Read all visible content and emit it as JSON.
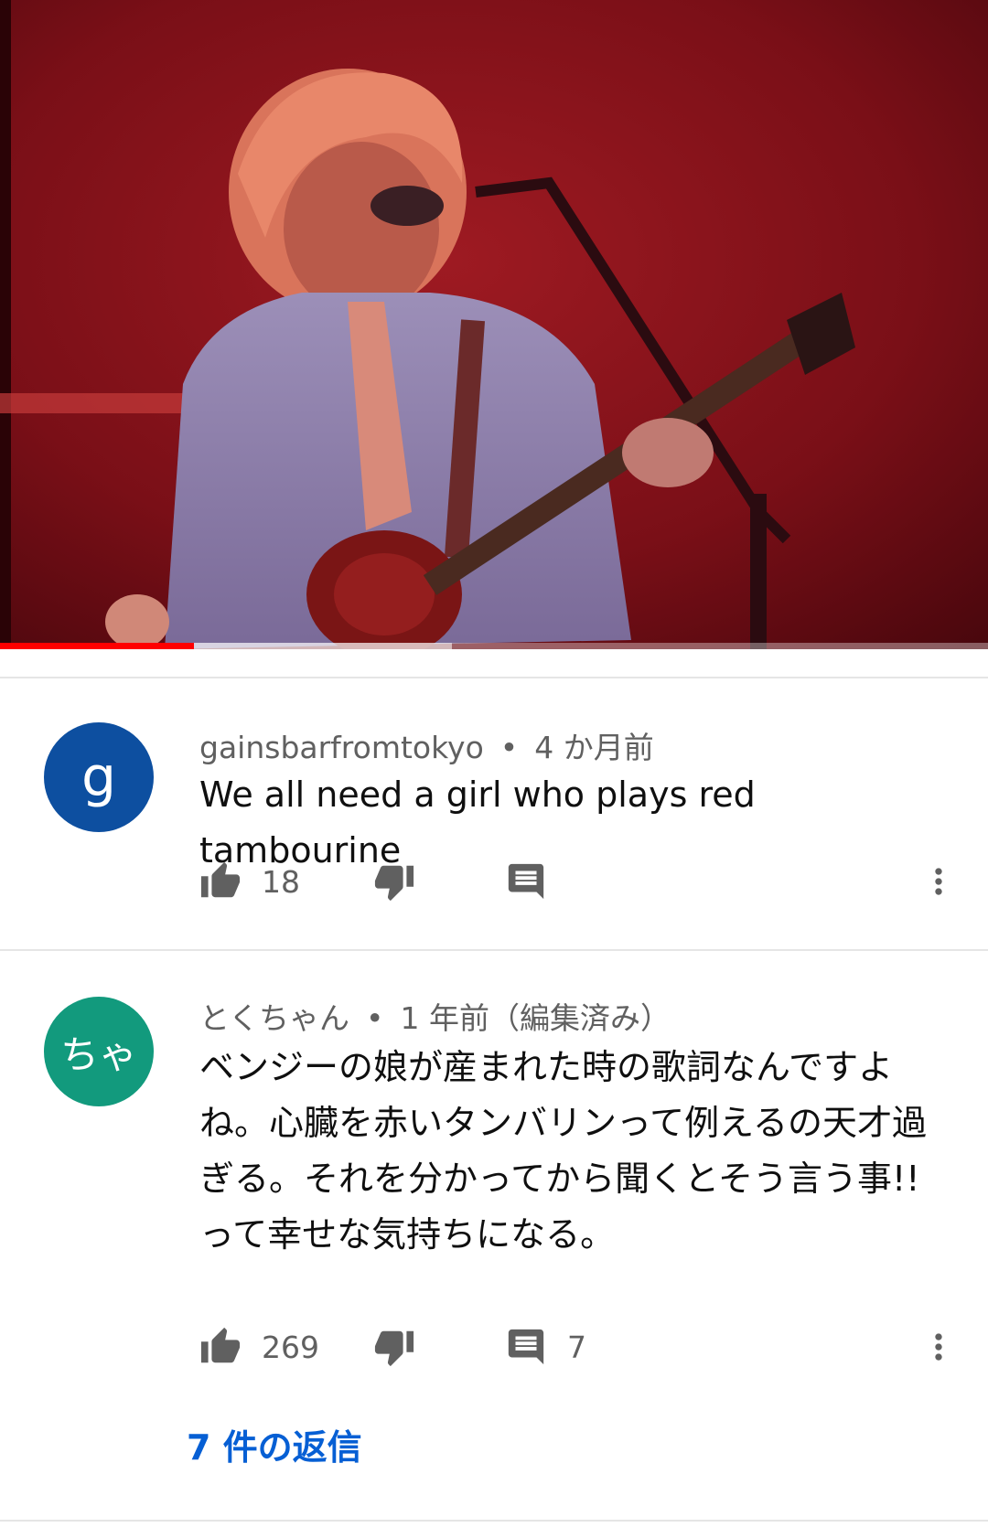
{
  "video": {
    "progress": {
      "played": 0.196,
      "buffered": 0.457
    }
  },
  "comments": [
    {
      "avatar_letter": "g",
      "avatar_color": "#0d4fa0",
      "author": "gainsbarfromtokyo",
      "separator": "•",
      "time": "4 か月前",
      "text": "We all need a girl who plays red tambourine",
      "like_count": "18",
      "reply_count": ""
    },
    {
      "avatar_letter": "ちゃ",
      "avatar_color": "#129a7d",
      "author": "とくちゃん",
      "separator": "•",
      "time": "1 年前（編集済み）",
      "text": "ベンジーの娘が産まれた時の歌詞なんですよね。心臓を赤いタンバリンって例えるの天才過ぎる。それを分かってから聞くとそう言う事!!って幸せな気持ちになる。",
      "like_count": "269",
      "reply_count": "7",
      "replies_link": "7 件の返信"
    }
  ],
  "icons": {
    "like": "thumb-up-icon",
    "dislike": "thumb-down-icon",
    "reply": "comment-icon",
    "more": "more-vert-icon"
  }
}
